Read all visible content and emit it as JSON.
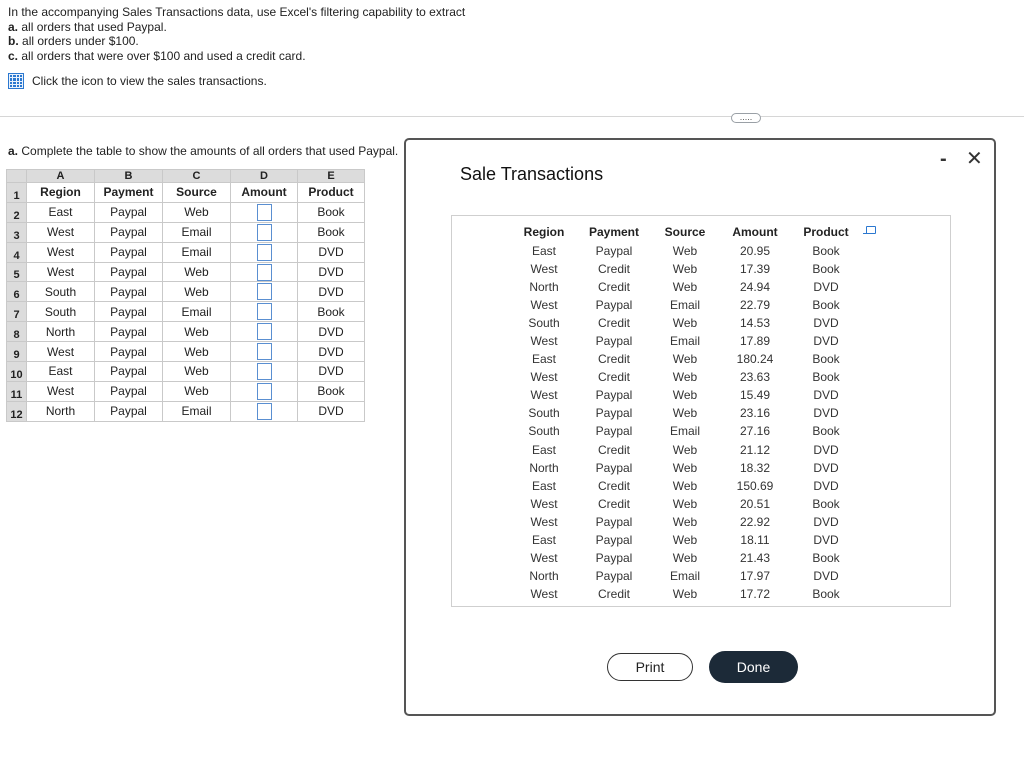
{
  "question": {
    "intro": "In the accompanying Sales Transactions data, use Excel's filtering capability to extract",
    "items": [
      {
        "letter": "a.",
        "text": "all orders that used Paypal."
      },
      {
        "letter": "b.",
        "text": "all orders under $100."
      },
      {
        "letter": "c.",
        "text": "all orders that were over $100 and used a credit card."
      }
    ],
    "view_link": "Click the icon to view the sales transactions.",
    "more_button": "....."
  },
  "part_a": {
    "letter": "a.",
    "prompt": "Complete the table to show the amounts of all orders that used Paypal."
  },
  "sheet": {
    "col_letters": [
      "A",
      "B",
      "C",
      "D",
      "E"
    ],
    "headers": [
      "Region",
      "Payment",
      "Source",
      "Amount",
      "Product"
    ],
    "row_numbers": [
      "1",
      "2",
      "3",
      "4",
      "5",
      "6",
      "7",
      "8",
      "9",
      "10",
      "11",
      "12"
    ],
    "rows": [
      [
        "East",
        "Paypal",
        "Web",
        "Book"
      ],
      [
        "West",
        "Paypal",
        "Email",
        "Book"
      ],
      [
        "West",
        "Paypal",
        "Email",
        "DVD"
      ],
      [
        "West",
        "Paypal",
        "Web",
        "DVD"
      ],
      [
        "South",
        "Paypal",
        "Web",
        "DVD"
      ],
      [
        "South",
        "Paypal",
        "Email",
        "Book"
      ],
      [
        "North",
        "Paypal",
        "Web",
        "DVD"
      ],
      [
        "West",
        "Paypal",
        "Web",
        "DVD"
      ],
      [
        "East",
        "Paypal",
        "Web",
        "DVD"
      ],
      [
        "West",
        "Paypal",
        "Web",
        "Book"
      ],
      [
        "North",
        "Paypal",
        "Email",
        "DVD"
      ]
    ]
  },
  "dialog": {
    "title": "Sale Transactions",
    "minimize": "-",
    "close": "✕",
    "headers": [
      "Region",
      "Payment",
      "Source",
      "Amount",
      "Product"
    ],
    "rows": [
      [
        "East",
        "Paypal",
        "Web",
        "20.95",
        "Book"
      ],
      [
        "West",
        "Credit",
        "Web",
        "17.39",
        "Book"
      ],
      [
        "North",
        "Credit",
        "Web",
        "24.94",
        "DVD"
      ],
      [
        "West",
        "Paypal",
        "Email",
        "22.79",
        "Book"
      ],
      [
        "South",
        "Credit",
        "Web",
        "14.53",
        "DVD"
      ],
      [
        "West",
        "Paypal",
        "Email",
        "17.89",
        "DVD"
      ],
      [
        "East",
        "Credit",
        "Web",
        "180.24",
        "Book"
      ],
      [
        "West",
        "Credit",
        "Web",
        "23.63",
        "Book"
      ],
      [
        "West",
        "Paypal",
        "Web",
        "15.49",
        "DVD"
      ],
      [
        "South",
        "Paypal",
        "Web",
        "23.16",
        "DVD"
      ],
      [
        "South",
        "Paypal",
        "Email",
        "27.16",
        "Book"
      ],
      [
        "East",
        "Credit",
        "Web",
        "21.12",
        "DVD"
      ],
      [
        "North",
        "Paypal",
        "Web",
        "18.32",
        "DVD"
      ],
      [
        "East",
        "Credit",
        "Web",
        "150.69",
        "DVD"
      ],
      [
        "West",
        "Credit",
        "Web",
        "20.51",
        "Book"
      ],
      [
        "West",
        "Paypal",
        "Web",
        "22.92",
        "DVD"
      ],
      [
        "East",
        "Paypal",
        "Web",
        "18.11",
        "DVD"
      ],
      [
        "West",
        "Paypal",
        "Web",
        "21.43",
        "Book"
      ],
      [
        "North",
        "Paypal",
        "Email",
        "17.97",
        "DVD"
      ],
      [
        "West",
        "Credit",
        "Web",
        "17.72",
        "Book"
      ]
    ],
    "print_label": "Print",
    "done_label": "Done"
  }
}
